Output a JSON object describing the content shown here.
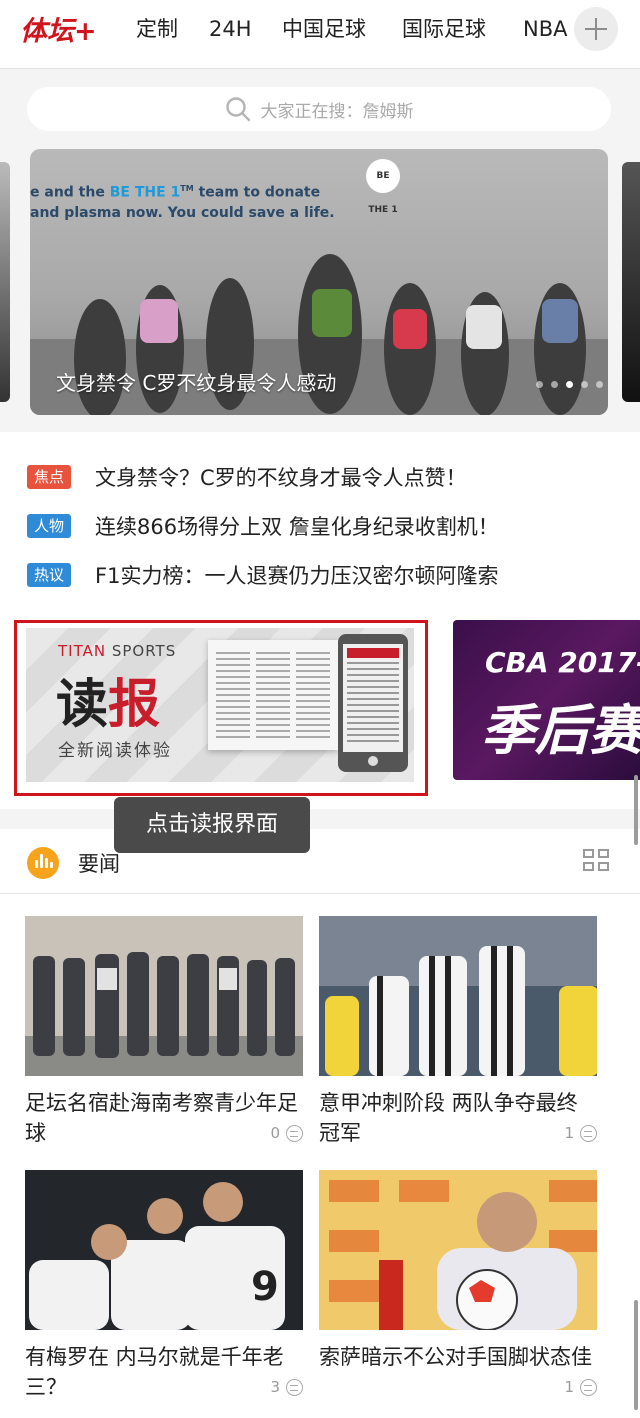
{
  "header": {
    "logo_text": "体坛+",
    "tabs": [
      {
        "label": "定制"
      },
      {
        "label": "24H"
      },
      {
        "label": "中国足球"
      },
      {
        "label": "国际足球"
      },
      {
        "label": "NBA"
      }
    ]
  },
  "search": {
    "placeholder": "大家正在搜：詹姆斯"
  },
  "banner": {
    "caption": "文身禁令 C罗不纹身最令人感动",
    "wall_text_line1_a": "e and the ",
    "wall_text_line1_hl": "BE THE 1",
    "wall_text_line1_b": " team to donate",
    "wall_text_line2": "and plasma now. You could save a life.",
    "badge_text": "BE THE 1",
    "slide_count": 6,
    "active_slide": 3
  },
  "news_list": [
    {
      "tag": "焦点",
      "tag_color": "#e8533e",
      "title": "文身禁令？C罗的不纹身才最令人点赞！"
    },
    {
      "tag": "人物",
      "tag_color": "#2f8bd8",
      "title": "连续866场得分上双 詹皇化身纪录收割机！"
    },
    {
      "tag": "热议",
      "tag_color": "#2f8bd8",
      "title": "F1实力榜：一人退赛仍力压汉密尔顿阿隆索"
    }
  ],
  "promo_reader": {
    "brand_a": "TITAN",
    "brand_b": " SPORTS",
    "big_a": "读",
    "big_b": "报",
    "sub": "全新阅读体验"
  },
  "promo_cba": {
    "line1": "CBA 2017-",
    "line2": "季后赛"
  },
  "tooltip": "点击读报界面",
  "section": {
    "label": "要闻",
    "accent": "#f7a31c"
  },
  "cards": [
    {
      "title": "足坛名宿赴海南考察青少年足球",
      "comments": "0"
    },
    {
      "title": "意甲冲刺阶段 两队争夺最终冠军",
      "comments": "1"
    },
    {
      "title": "有梅罗在 内马尔就是千年老三？",
      "comments": "3"
    },
    {
      "title": "索萨暗示不公对手国脚状态佳",
      "comments": "1"
    }
  ],
  "colors": {
    "brand_red": "#d0141c",
    "tag_red": "#e8533e",
    "tag_blue": "#2f8bd8"
  }
}
